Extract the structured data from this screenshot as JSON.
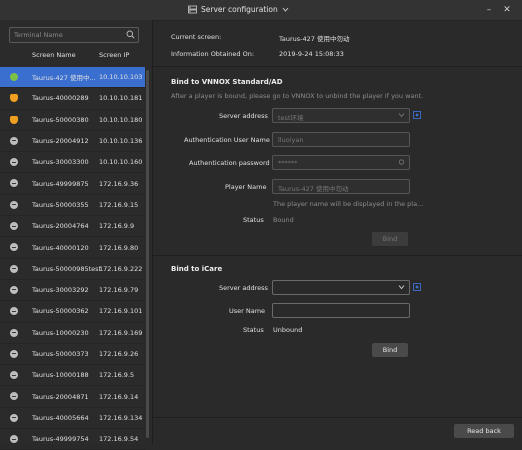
{
  "window": {
    "title": "Server configuration"
  },
  "sidebar": {
    "search_placeholder": "Terminal Name",
    "columns": {
      "name": "Screen Name",
      "ip": "Screen IP"
    },
    "rows": [
      {
        "name": "Taurus-427 使用中...",
        "ip": "10.10.10.103",
        "status": "online"
      },
      {
        "name": "Taurus-40000289",
        "ip": "10.10.10.181",
        "status": "warning"
      },
      {
        "name": "Taurus-50000380",
        "ip": "10.10.10.180",
        "status": "warning"
      },
      {
        "name": "Taurus-20004912",
        "ip": "10.10.10.136",
        "status": "offline"
      },
      {
        "name": "Taurus-30003300",
        "ip": "10.10.10.160",
        "status": "offline"
      },
      {
        "name": "Taurus-49999875",
        "ip": "172.16.9.36",
        "status": "offline"
      },
      {
        "name": "Taurus-50000355",
        "ip": "172.16.9.15",
        "status": "offline"
      },
      {
        "name": "Taurus-20004764",
        "ip": "172.16.9.9",
        "status": "offline"
      },
      {
        "name": "Taurus-40000120",
        "ip": "172.16.9.80",
        "status": "offline"
      },
      {
        "name": "Taurus-50000985test",
        "ip": "172.16.9.222",
        "status": "offline"
      },
      {
        "name": "Taurus-30003292",
        "ip": "172.16.9.79",
        "status": "offline"
      },
      {
        "name": "Taurus-50000362",
        "ip": "172.16.9.101",
        "status": "offline"
      },
      {
        "name": "Taurus-10000230",
        "ip": "172.16.9.169",
        "status": "offline"
      },
      {
        "name": "Taurus-50000373",
        "ip": "172.16.9.26",
        "status": "offline"
      },
      {
        "name": "Taurus-10000188",
        "ip": "172.16.9.5",
        "status": "offline"
      },
      {
        "name": "Taurus-20004871",
        "ip": "172.16.9.14",
        "status": "offline"
      },
      {
        "name": "Taurus-40005664",
        "ip": "172.16.9.134",
        "status": "offline"
      },
      {
        "name": "Taurus-49999754",
        "ip": "172.16.9.54",
        "status": "offline"
      }
    ]
  },
  "info": {
    "current_screen_label": "Current screen:",
    "current_screen_value": "Taurus-427 使用中勿动",
    "obtained_label": "Information Obtained On:",
    "obtained_value": "2019-9-24 15:08:33"
  },
  "vnnox": {
    "heading": "Bind to VNNOX Standard/AD",
    "hint": "After a player is bound, please go to VNNOX to unbind the player if you want.",
    "server_label": "Server address",
    "server_value": "test环境",
    "user_label": "Authentication User Name",
    "user_value": "lluoiyan",
    "password_label": "Authentication password",
    "password_value": "******",
    "player_label": "Player Name",
    "player_value": "Taurus-427 使用中勿动",
    "player_hint": "The player name will be displayed in the pla...",
    "status_label": "Status",
    "status_value": "Bound",
    "bind_label": "Bind"
  },
  "icare": {
    "heading": "Bind to iCare",
    "server_label": "Server address",
    "server_value": "",
    "user_label": "User Name",
    "user_value": "",
    "status_label": "Status",
    "status_value": "Unbound",
    "bind_label": "Bind"
  },
  "footer": {
    "read_back_label": "Read back"
  },
  "colors": {
    "accent": "#3a6fd0",
    "online": "#7cc04a",
    "warning": "#f0a020",
    "offline": "#a8a8a8"
  }
}
